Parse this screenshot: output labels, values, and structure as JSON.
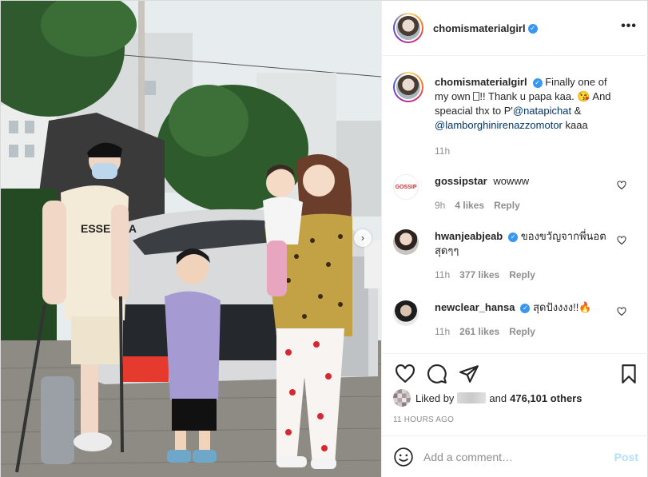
{
  "header": {
    "username": "chomismaterialgirl",
    "verified": true,
    "more_label": "•••"
  },
  "caption": {
    "username": "chomismaterialgirl",
    "text_part1": "Finally one of my own ",
    "text_part2": "!! Thank u papa kaa. ",
    "emoji_wink": "😘",
    "text_part3": " And speacial thx to P'",
    "mention1": "@natapichat",
    "text_part4": " & ",
    "mention2": "@lamborghinirenazzomotor",
    "text_part5": " kaaa",
    "time": "11h"
  },
  "comments": [
    {
      "username": "gossipstar",
      "verified": false,
      "text": "wowww",
      "time": "9h",
      "likes": "4 likes",
      "reply": "Reply",
      "avatar_text": "GOSSIP"
    },
    {
      "username": "hwanjeabjeab",
      "verified": true,
      "text": "ของขวัญจากพี่นอต สุดๆๆ",
      "time": "11h",
      "likes": "377 likes",
      "reply": "Reply"
    },
    {
      "username": "newclear_hansa",
      "verified": true,
      "text": "สุดปังงงง!!🔥",
      "time": "11h",
      "likes": "261 likes",
      "reply": "Reply"
    }
  ],
  "likes": {
    "prefix": "Liked by",
    "suffix_and": "and",
    "others": "476,101 others"
  },
  "timestamp": "11 HOURS AGO",
  "add_comment": {
    "placeholder": "Add a comment…",
    "post_label": "Post"
  },
  "icons": {
    "like": "heart-icon",
    "comment": "comment-icon",
    "share": "send-icon",
    "save": "bookmark-icon",
    "emoji": "smiley-icon",
    "next": "chevron-right-icon"
  },
  "colors": {
    "verified": "#3897f0",
    "link": "#00376b",
    "muted": "#8e8e8e",
    "post_disabled": "#b2dffc"
  }
}
